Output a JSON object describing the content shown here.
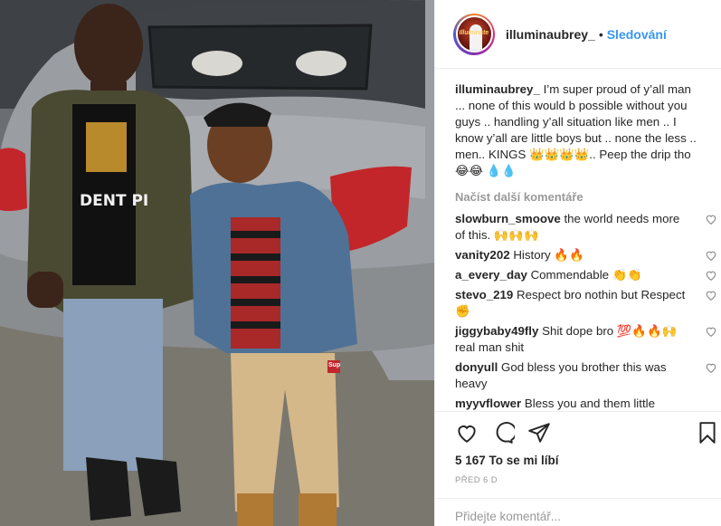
{
  "post": {
    "username": "illuminaubrey_",
    "separator": "•",
    "follow_label": "Sledování",
    "avatar_text": "Illuminate",
    "photo_text": {
      "shirt": "DENT PI",
      "sticker": "Sup"
    }
  },
  "caption": {
    "username": "illuminaubrey_",
    "text": "I’m super proud of y’all man ... none of this would b possible without you guys .. handling y’all situation like men .. I know y’all are little boys but .. none the less .. men.. KINGS 👑👑👑👑.. Peep the drip tho 😂😂 💧💧"
  },
  "load_more_label": "Načíst další komentáře",
  "comments": [
    {
      "username": "slowburn_smoove",
      "text": "the world needs more of this. 🙌🙌🙌"
    },
    {
      "username": "vanity202",
      "text": "History 🔥🔥"
    },
    {
      "username": "a_every_day",
      "text": "Commendable 👏👏"
    },
    {
      "username": "stevo_219",
      "text": "Respect bro nothin but Respect✊"
    },
    {
      "username": "jiggybaby49fly",
      "text": "Shit dope bro 💯🔥🔥🙌 real man shit"
    },
    {
      "username": "donyull",
      "text": "God bless you brother this was heavy"
    },
    {
      "username": "myyvflower",
      "text": "Bless you and them little"
    }
  ],
  "icons": {
    "like": "heart-icon",
    "comment": "comment-icon",
    "share": "share-icon",
    "save": "bookmark-icon",
    "comment_like": "heart-outline-icon"
  },
  "likes_text": "5 167 To se mi líbí",
  "timestamp": "PŘED 6 D",
  "add_comment_placeholder": "Přidejte komentář...",
  "colors": {
    "link": "#3897f0",
    "muted": "#999999",
    "text": "#262626"
  }
}
